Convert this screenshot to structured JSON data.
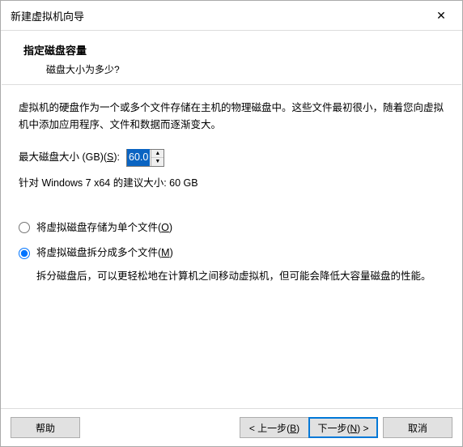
{
  "window": {
    "title": "新建虚拟机向导"
  },
  "header": {
    "heading": "指定磁盘容量",
    "subheading": "磁盘大小为多少?"
  },
  "description": "虚拟机的硬盘作为一个或多个文件存储在主机的物理磁盘中。这些文件最初很小，随着您向虚拟机中添加应用程序、文件和数据而逐渐变大。",
  "sizeRow": {
    "labelPrefix": "最大磁盘大小 (GB)(",
    "labelHotkey": "S",
    "labelSuffix": "):",
    "value": "60.0"
  },
  "recommend": "针对 Windows 7 x64 的建议大小: 60 GB",
  "radios": {
    "single": {
      "labelPrefix": "将虚拟磁盘存储为单个文件(",
      "hotkey": "O",
      "labelSuffix": ")"
    },
    "split": {
      "labelPrefix": "将虚拟磁盘拆分成多个文件(",
      "hotkey": "M",
      "labelSuffix": ")",
      "desc": "拆分磁盘后，可以更轻松地在计算机之间移动虚拟机，但可能会降低大容量磁盘的性能。"
    }
  },
  "buttons": {
    "help": "帮助",
    "back": {
      "pre": "< 上一步(",
      "hot": "B",
      "suf": ")"
    },
    "next": {
      "pre": "下一步(",
      "hot": "N",
      "suf": ") >"
    },
    "cancel": "取消"
  }
}
